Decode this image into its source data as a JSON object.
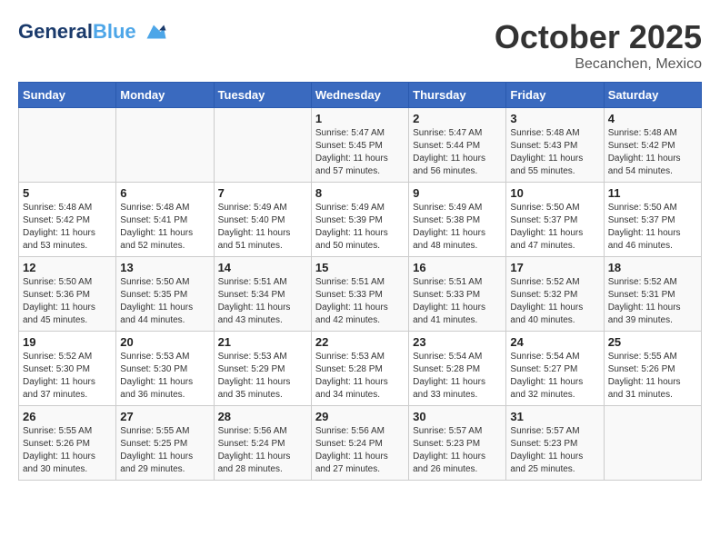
{
  "header": {
    "logo_line1": "General",
    "logo_line2": "Blue",
    "month": "October 2025",
    "location": "Becanchen, Mexico"
  },
  "weekdays": [
    "Sunday",
    "Monday",
    "Tuesday",
    "Wednesday",
    "Thursday",
    "Friday",
    "Saturday"
  ],
  "weeks": [
    [
      {
        "day": "",
        "sunrise": "",
        "sunset": "",
        "daylight": ""
      },
      {
        "day": "",
        "sunrise": "",
        "sunset": "",
        "daylight": ""
      },
      {
        "day": "",
        "sunrise": "",
        "sunset": "",
        "daylight": ""
      },
      {
        "day": "1",
        "sunrise": "Sunrise: 5:47 AM",
        "sunset": "Sunset: 5:45 PM",
        "daylight": "Daylight: 11 hours and 57 minutes."
      },
      {
        "day": "2",
        "sunrise": "Sunrise: 5:47 AM",
        "sunset": "Sunset: 5:44 PM",
        "daylight": "Daylight: 11 hours and 56 minutes."
      },
      {
        "day": "3",
        "sunrise": "Sunrise: 5:48 AM",
        "sunset": "Sunset: 5:43 PM",
        "daylight": "Daylight: 11 hours and 55 minutes."
      },
      {
        "day": "4",
        "sunrise": "Sunrise: 5:48 AM",
        "sunset": "Sunset: 5:42 PM",
        "daylight": "Daylight: 11 hours and 54 minutes."
      }
    ],
    [
      {
        "day": "5",
        "sunrise": "Sunrise: 5:48 AM",
        "sunset": "Sunset: 5:42 PM",
        "daylight": "Daylight: 11 hours and 53 minutes."
      },
      {
        "day": "6",
        "sunrise": "Sunrise: 5:48 AM",
        "sunset": "Sunset: 5:41 PM",
        "daylight": "Daylight: 11 hours and 52 minutes."
      },
      {
        "day": "7",
        "sunrise": "Sunrise: 5:49 AM",
        "sunset": "Sunset: 5:40 PM",
        "daylight": "Daylight: 11 hours and 51 minutes."
      },
      {
        "day": "8",
        "sunrise": "Sunrise: 5:49 AM",
        "sunset": "Sunset: 5:39 PM",
        "daylight": "Daylight: 11 hours and 50 minutes."
      },
      {
        "day": "9",
        "sunrise": "Sunrise: 5:49 AM",
        "sunset": "Sunset: 5:38 PM",
        "daylight": "Daylight: 11 hours and 48 minutes."
      },
      {
        "day": "10",
        "sunrise": "Sunrise: 5:50 AM",
        "sunset": "Sunset: 5:37 PM",
        "daylight": "Daylight: 11 hours and 47 minutes."
      },
      {
        "day": "11",
        "sunrise": "Sunrise: 5:50 AM",
        "sunset": "Sunset: 5:37 PM",
        "daylight": "Daylight: 11 hours and 46 minutes."
      }
    ],
    [
      {
        "day": "12",
        "sunrise": "Sunrise: 5:50 AM",
        "sunset": "Sunset: 5:36 PM",
        "daylight": "Daylight: 11 hours and 45 minutes."
      },
      {
        "day": "13",
        "sunrise": "Sunrise: 5:50 AM",
        "sunset": "Sunset: 5:35 PM",
        "daylight": "Daylight: 11 hours and 44 minutes."
      },
      {
        "day": "14",
        "sunrise": "Sunrise: 5:51 AM",
        "sunset": "Sunset: 5:34 PM",
        "daylight": "Daylight: 11 hours and 43 minutes."
      },
      {
        "day": "15",
        "sunrise": "Sunrise: 5:51 AM",
        "sunset": "Sunset: 5:33 PM",
        "daylight": "Daylight: 11 hours and 42 minutes."
      },
      {
        "day": "16",
        "sunrise": "Sunrise: 5:51 AM",
        "sunset": "Sunset: 5:33 PM",
        "daylight": "Daylight: 11 hours and 41 minutes."
      },
      {
        "day": "17",
        "sunrise": "Sunrise: 5:52 AM",
        "sunset": "Sunset: 5:32 PM",
        "daylight": "Daylight: 11 hours and 40 minutes."
      },
      {
        "day": "18",
        "sunrise": "Sunrise: 5:52 AM",
        "sunset": "Sunset: 5:31 PM",
        "daylight": "Daylight: 11 hours and 39 minutes."
      }
    ],
    [
      {
        "day": "19",
        "sunrise": "Sunrise: 5:52 AM",
        "sunset": "Sunset: 5:30 PM",
        "daylight": "Daylight: 11 hours and 37 minutes."
      },
      {
        "day": "20",
        "sunrise": "Sunrise: 5:53 AM",
        "sunset": "Sunset: 5:30 PM",
        "daylight": "Daylight: 11 hours and 36 minutes."
      },
      {
        "day": "21",
        "sunrise": "Sunrise: 5:53 AM",
        "sunset": "Sunset: 5:29 PM",
        "daylight": "Daylight: 11 hours and 35 minutes."
      },
      {
        "day": "22",
        "sunrise": "Sunrise: 5:53 AM",
        "sunset": "Sunset: 5:28 PM",
        "daylight": "Daylight: 11 hours and 34 minutes."
      },
      {
        "day": "23",
        "sunrise": "Sunrise: 5:54 AM",
        "sunset": "Sunset: 5:28 PM",
        "daylight": "Daylight: 11 hours and 33 minutes."
      },
      {
        "day": "24",
        "sunrise": "Sunrise: 5:54 AM",
        "sunset": "Sunset: 5:27 PM",
        "daylight": "Daylight: 11 hours and 32 minutes."
      },
      {
        "day": "25",
        "sunrise": "Sunrise: 5:55 AM",
        "sunset": "Sunset: 5:26 PM",
        "daylight": "Daylight: 11 hours and 31 minutes."
      }
    ],
    [
      {
        "day": "26",
        "sunrise": "Sunrise: 5:55 AM",
        "sunset": "Sunset: 5:26 PM",
        "daylight": "Daylight: 11 hours and 30 minutes."
      },
      {
        "day": "27",
        "sunrise": "Sunrise: 5:55 AM",
        "sunset": "Sunset: 5:25 PM",
        "daylight": "Daylight: 11 hours and 29 minutes."
      },
      {
        "day": "28",
        "sunrise": "Sunrise: 5:56 AM",
        "sunset": "Sunset: 5:24 PM",
        "daylight": "Daylight: 11 hours and 28 minutes."
      },
      {
        "day": "29",
        "sunrise": "Sunrise: 5:56 AM",
        "sunset": "Sunset: 5:24 PM",
        "daylight": "Daylight: 11 hours and 27 minutes."
      },
      {
        "day": "30",
        "sunrise": "Sunrise: 5:57 AM",
        "sunset": "Sunset: 5:23 PM",
        "daylight": "Daylight: 11 hours and 26 minutes."
      },
      {
        "day": "31",
        "sunrise": "Sunrise: 5:57 AM",
        "sunset": "Sunset: 5:23 PM",
        "daylight": "Daylight: 11 hours and 25 minutes."
      },
      {
        "day": "",
        "sunrise": "",
        "sunset": "",
        "daylight": ""
      }
    ]
  ]
}
